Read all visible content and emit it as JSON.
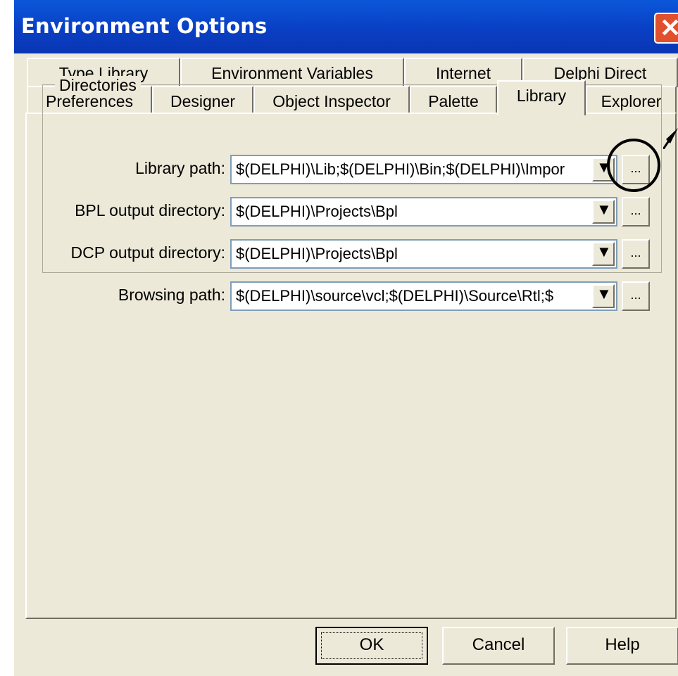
{
  "window": {
    "title": "Environment Options"
  },
  "tabs": {
    "row1": [
      "Type Library",
      "Environment Variables",
      "Internet",
      "Delphi Direct"
    ],
    "row2": [
      "Preferences",
      "Designer",
      "Object Inspector",
      "Palette",
      "Library",
      "Explorer"
    ],
    "active": "Library"
  },
  "directories": {
    "group_label": "Directories",
    "rows": [
      {
        "label": "Library path:",
        "value": "$(DELPHI)\\Lib;$(DELPHI)\\Bin;$(DELPHI)\\Impor",
        "browse": "..."
      },
      {
        "label": "BPL output directory:",
        "value": "$(DELPHI)\\Projects\\Bpl",
        "browse": "..."
      },
      {
        "label": "DCP output directory:",
        "value": "$(DELPHI)\\Projects\\Bpl",
        "browse": "..."
      },
      {
        "label": "Browsing path:",
        "value": "$(DELPHI)\\source\\vcl;$(DELPHI)\\Source\\Rtl;$",
        "browse": "..."
      }
    ]
  },
  "buttons": {
    "ok": "OK",
    "cancel": "Cancel",
    "help": "Help"
  },
  "icons": {
    "close": "close-icon",
    "dropdown": "chevron-down-icon"
  },
  "colors": {
    "titlebar": "#0a3fc4",
    "face": "#ece9d8",
    "close": "#e0502c"
  }
}
